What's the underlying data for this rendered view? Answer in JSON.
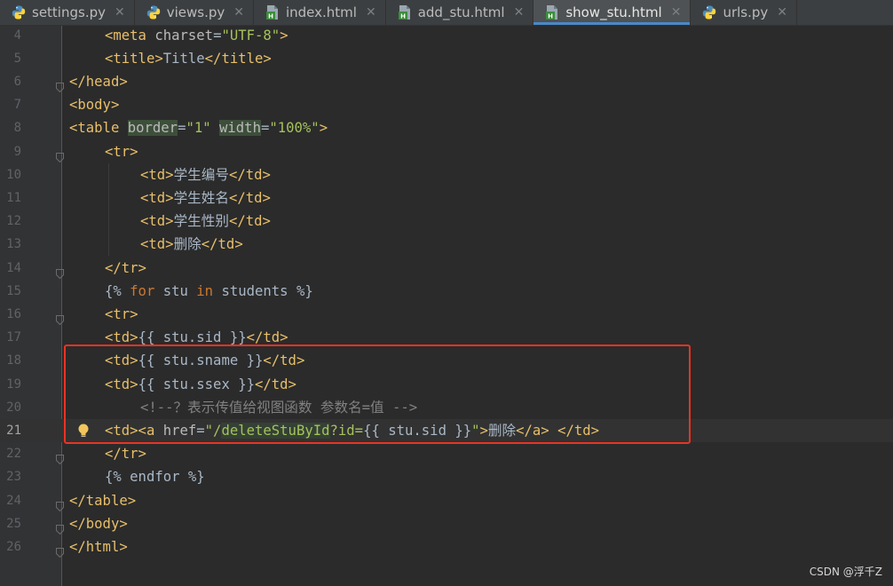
{
  "tabs": [
    {
      "label": "settings.py",
      "kind": "python"
    },
    {
      "label": "views.py",
      "kind": "python"
    },
    {
      "label": "index.html",
      "kind": "html"
    },
    {
      "label": "add_stu.html",
      "kind": "html"
    },
    {
      "label": "show_stu.html",
      "kind": "html",
      "active": true
    },
    {
      "label": "urls.py",
      "kind": "python"
    }
  ],
  "close_glyph": "✕",
  "colors": {
    "tag": "#e8bf6a",
    "attribute": "#bababa",
    "string": "#a5c25c",
    "keyword": "#cc7832",
    "comment": "#808080",
    "highlight_box": "#ea3324"
  },
  "editor": {
    "caret_line": 21,
    "lines": [
      {
        "n": "4",
        "tokens": [
          [
            "tg",
            "<meta "
          ],
          [
            "at",
            "charset"
          ],
          [
            "tx",
            "="
          ],
          [
            "st",
            "\"UTF-8\""
          ],
          [
            "tg",
            ">"
          ]
        ]
      },
      {
        "n": "5",
        "tokens": [
          [
            "tg",
            "<title>"
          ],
          [
            "tx",
            "Title"
          ],
          [
            "tg",
            "</title>"
          ]
        ]
      },
      {
        "n": "6",
        "tokens": [
          [
            "tg",
            "</head>"
          ]
        ]
      },
      {
        "n": "7",
        "tokens": [
          [
            "tg",
            "<body>"
          ]
        ]
      },
      {
        "n": "8",
        "tokens": [
          [
            "tg",
            "<table "
          ],
          [
            "at hl",
            "border"
          ],
          [
            "tx",
            "="
          ],
          [
            "st",
            "\"1\" "
          ],
          [
            "at hl",
            "width"
          ],
          [
            "tx",
            "="
          ],
          [
            "st",
            "\"100%\""
          ],
          [
            "tg",
            ">"
          ]
        ]
      },
      {
        "n": "9",
        "tokens": [
          [
            "tg",
            "<tr>"
          ]
        ]
      },
      {
        "n": "10",
        "tokens": [
          [
            "tg",
            "<td>"
          ],
          [
            "tx",
            "学生编号"
          ],
          [
            "tg",
            "</td>"
          ]
        ]
      },
      {
        "n": "11",
        "tokens": [
          [
            "tg",
            "<td>"
          ],
          [
            "tx",
            "学生姓名"
          ],
          [
            "tg",
            "</td>"
          ]
        ]
      },
      {
        "n": "12",
        "tokens": [
          [
            "tg",
            "<td>"
          ],
          [
            "tx",
            "学生性别"
          ],
          [
            "tg",
            "</td>"
          ]
        ]
      },
      {
        "n": "13",
        "tokens": [
          [
            "tg",
            "<td>"
          ],
          [
            "tx",
            "删除"
          ],
          [
            "tg",
            "</td>"
          ]
        ]
      },
      {
        "n": "14",
        "tokens": [
          [
            "tg",
            "</tr>"
          ]
        ]
      },
      {
        "n": "15",
        "tokens": [
          [
            "tx",
            "{% "
          ],
          [
            "kw",
            "for "
          ],
          [
            "tx",
            "stu "
          ],
          [
            "kw",
            "in "
          ],
          [
            "tx",
            "students %}"
          ]
        ]
      },
      {
        "n": "16",
        "tokens": [
          [
            "tg",
            "<tr>"
          ]
        ]
      },
      {
        "n": "17",
        "tokens": [
          [
            "tg",
            "<td>"
          ],
          [
            "tx",
            "{{ stu.sid }}"
          ],
          [
            "tg",
            "</td>"
          ]
        ]
      },
      {
        "n": "18",
        "tokens": [
          [
            "tg",
            "<td>"
          ],
          [
            "tx",
            "{{ stu.sname }}"
          ],
          [
            "tg",
            "</td>"
          ]
        ]
      },
      {
        "n": "19",
        "tokens": [
          [
            "tg",
            "<td>"
          ],
          [
            "tx",
            "{{ stu.ssex }}"
          ],
          [
            "tg",
            "</td>"
          ]
        ]
      },
      {
        "n": "20",
        "tokens": [
          [
            "cm",
            "<!--？表示传值给视图函数 参数名=值 -->"
          ]
        ]
      },
      {
        "n": "21",
        "tokens": [
          [
            "tg",
            "<td><a "
          ],
          [
            "at",
            "href"
          ],
          [
            "tx",
            "="
          ],
          [
            "st",
            "\"/"
          ],
          [
            "st hl2",
            "deleteStuById"
          ],
          [
            "st",
            "?id="
          ],
          [
            "tx",
            "{{ stu.sid }}"
          ],
          [
            "st",
            "\""
          ],
          [
            "tg",
            ">"
          ],
          [
            "tx",
            "删除"
          ],
          [
            "tg",
            "</a> </td>"
          ]
        ]
      },
      {
        "n": "22",
        "tokens": [
          [
            "tg",
            "</tr>"
          ]
        ]
      },
      {
        "n": "23",
        "tokens": [
          [
            "tx",
            "{% endfor %}"
          ]
        ]
      },
      {
        "n": "24",
        "tokens": [
          [
            "tg",
            "</table>"
          ]
        ]
      },
      {
        "n": "25",
        "tokens": [
          [
            "tg",
            "</body>"
          ]
        ]
      },
      {
        "n": "26",
        "tokens": [
          [
            "tg",
            "</html>"
          ]
        ]
      }
    ]
  },
  "watermark": "CSDN @浮千Z"
}
